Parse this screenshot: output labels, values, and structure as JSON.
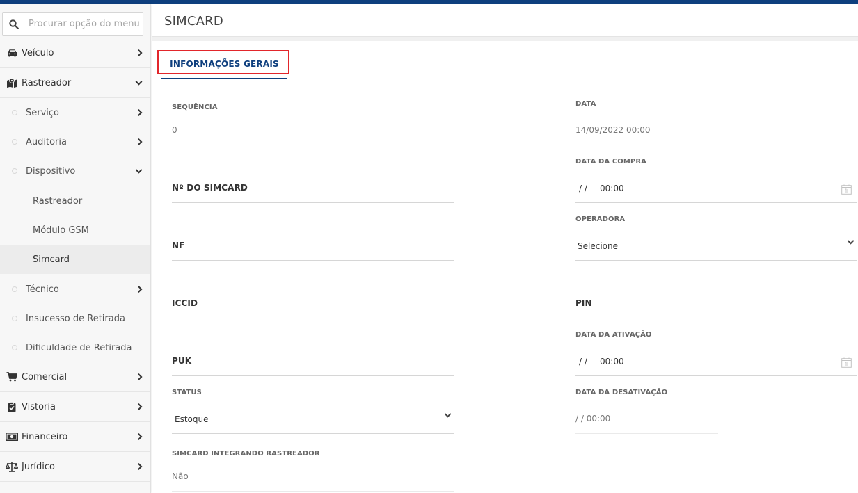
{
  "sidebar": {
    "search_placeholder": "Procurar opção do menu...",
    "items": {
      "veiculo": "Veículo",
      "rastreador": "Rastreador",
      "servico": "Serviço",
      "auditoria": "Auditoria",
      "dispositivo": "Dispositivo",
      "disp_rastreador": "Rastreador",
      "modulo_gsm": "Módulo GSM",
      "simcard": "Simcard",
      "tecnico": "Técnico",
      "insucesso": "Insucesso de Retirada",
      "dificuldade": "Dificuldade de Retirada",
      "comercial": "Comercial",
      "vistoria": "Vistoria",
      "financeiro": "Financeiro",
      "juridico": "Jurídico"
    }
  },
  "header": {
    "title": "SIMCARD"
  },
  "tabs": {
    "general": "INFORMAÇÕES GERAIS"
  },
  "form": {
    "sequencia": {
      "label": "SEQUÊNCIA",
      "value": "0"
    },
    "numero_simcard": {
      "label": "Nº DO SIMCARD"
    },
    "nf": {
      "label": "NF"
    },
    "iccid": {
      "label": "ICCID"
    },
    "puk": {
      "label": "PUK"
    },
    "status": {
      "label": "STATUS",
      "value": "Estoque"
    },
    "integrando": {
      "label": "SIMCARD INTEGRANDO RASTREADOR",
      "value": "Não"
    },
    "data": {
      "label": "DATA",
      "value": "14/09/2022 00:00"
    },
    "data_compra": {
      "label": "DATA DA COMPRA",
      "date": "/ /",
      "time": "00:00"
    },
    "operadora": {
      "label": "OPERADORA",
      "value": "Selecione"
    },
    "pin": {
      "label": "PIN"
    },
    "data_ativacao": {
      "label": "DATA DA ATIVAÇÃO",
      "date": "/ /",
      "time": "00:00"
    },
    "data_desativacao": {
      "label": "DATA DA DESATIVAÇÃO",
      "value": "/ / 00:00"
    }
  },
  "colors": {
    "brand": "#0e3f7e",
    "highlight": "#e2262b"
  }
}
